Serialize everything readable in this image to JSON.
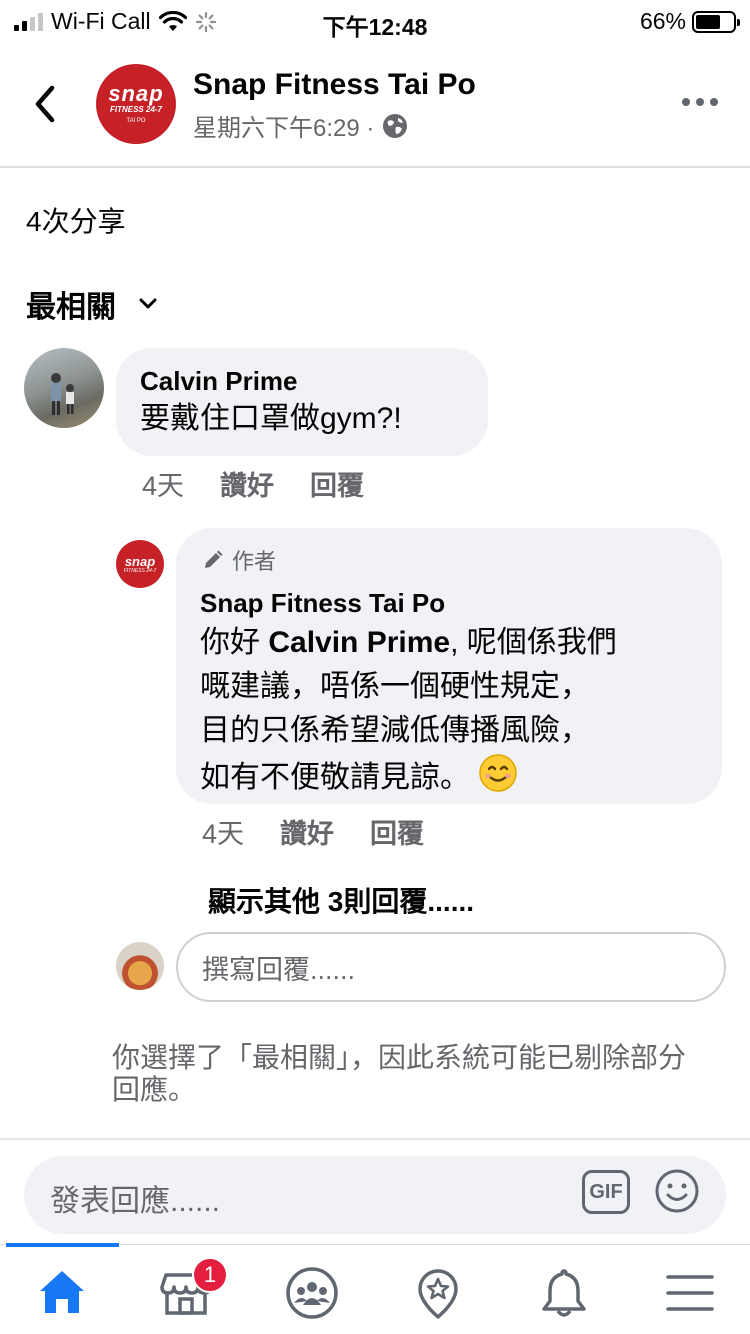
{
  "status_bar": {
    "carrier": "Wi-Fi Call",
    "time": "下午12:48",
    "battery": "66%",
    "battery_level": 0.66
  },
  "header": {
    "title": "Snap Fitness Tai Po",
    "subtitle": "星期六下午6:29 ·",
    "logo_text": "snap",
    "logo_sub": "FITNESS 24-7",
    "logo_loc": "TAI PO"
  },
  "shares": "4次分享",
  "sort": {
    "label": "最相關"
  },
  "comments": [
    {
      "author": "Calvin Prime",
      "text": "要戴住口罩做gym?!",
      "time": "4天",
      "like": "讚好",
      "reply": "回覆"
    }
  ],
  "reply": {
    "badge": "作者",
    "author": "Snap Fitness Tai Po",
    "text_pre": "你好 ",
    "mention": "Calvin Prime",
    "line1_rest": ", 呢個係我們",
    "line2": "嘅建議，唔係一個硬性規定，",
    "line3": "目的只係希望減低傳播風險，",
    "line4": "如有不便敬請見諒。",
    "emoji": "smiling-face-emoji",
    "time": "4天",
    "like": "讚好",
    "reply": "回覆"
  },
  "more_replies": "顯示其他 3則回覆......",
  "reply_input": {
    "placeholder": "撰寫回覆......"
  },
  "notice": "你選擇了「最相關」，因此系統可能已剔除部分回應。",
  "composer": {
    "placeholder": "發表回應......",
    "gif": "GIF"
  },
  "tabbar": {
    "items": [
      "home-icon",
      "marketplace-icon",
      "groups-icon",
      "pages-icon",
      "notifications-icon",
      "menu-icon"
    ],
    "marketplace_badge": "1",
    "active": "home-icon",
    "accent": "#1877f2",
    "badge_color": "#e41e3f"
  },
  "colors": {
    "logo_red": "#c62127",
    "bubble": "#f0f2f5",
    "secondary_text": "#65676b"
  }
}
